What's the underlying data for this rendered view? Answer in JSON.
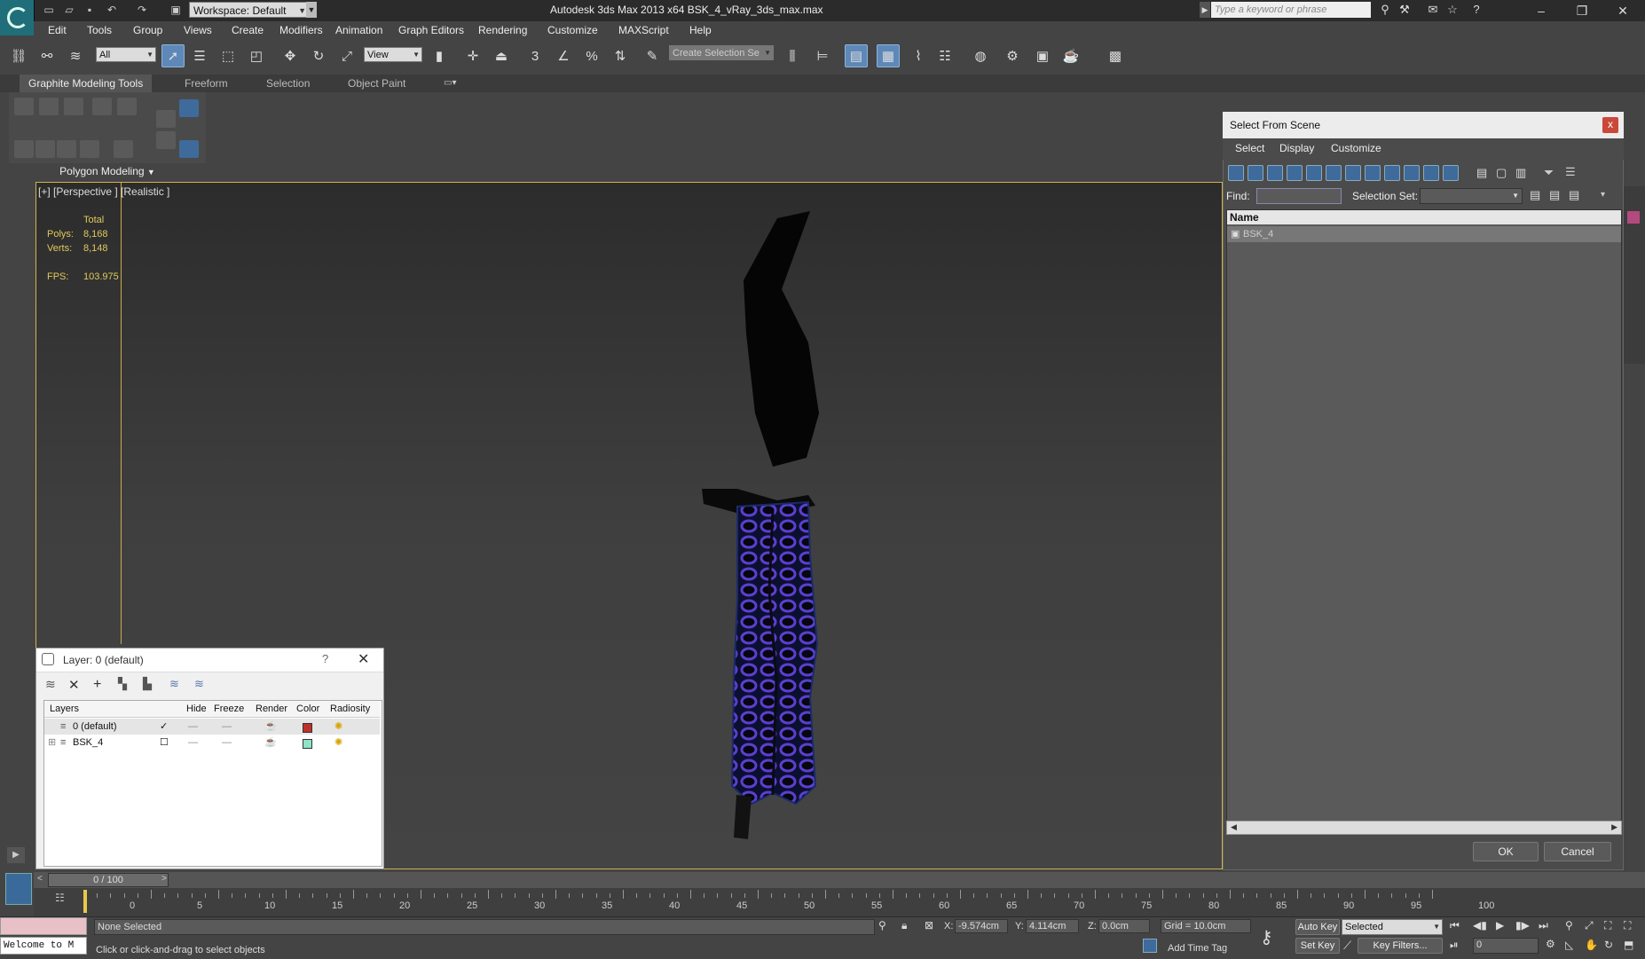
{
  "window": {
    "title": "Autodesk 3ds Max  2013 x64     BSK_4_vRay_3ds_max.max",
    "workspace": "Workspace: Default",
    "search_placeholder": "Type a keyword or phrase",
    "controls": [
      "–",
      "❐",
      "✕"
    ]
  },
  "menu": [
    "Edit",
    "Tools",
    "Group",
    "Views",
    "Create",
    "Modifiers",
    "Animation",
    "Graph Editors",
    "Rendering",
    "Customize",
    "MAXScript",
    "Help"
  ],
  "main_toolbar": {
    "selection_filter": "All",
    "ref_coord": "View",
    "named_selection_placeholder": "Create Selection Se"
  },
  "ribbon": {
    "tabs": [
      "Graphite Modeling Tools",
      "Freeform",
      "Selection",
      "Object Paint"
    ],
    "panel_label": "Polygon Modeling"
  },
  "viewport": {
    "label": "[+] [Perspective ] [Realistic ]",
    "stats": {
      "total_label": "Total",
      "polys_label": "Polys:",
      "polys": "8,168",
      "verts_label": "Verts:",
      "verts": "8,148",
      "fps_label": "FPS:",
      "fps": "103.975"
    }
  },
  "layer_dialog": {
    "title": "Layer: 0 (default)",
    "help": "?",
    "columns": [
      "Layers",
      "Hide",
      "Freeze",
      "Render",
      "Color",
      "Radiosity"
    ],
    "rows": [
      {
        "name": "0 (default)",
        "color": "#c0302a",
        "active": true
      },
      {
        "name": "BSK_4",
        "color": "#8ee3c8",
        "active": false
      }
    ]
  },
  "select_from_scene": {
    "title": "Select From Scene",
    "menu": [
      "Select",
      "Display",
      "Customize"
    ],
    "find_label": "Find:",
    "selection_set_label": "Selection Set:",
    "column_name": "Name",
    "items": [
      "BSK_4"
    ],
    "ok": "OK",
    "cancel": "Cancel"
  },
  "timeline": {
    "frame_display": "0 / 100",
    "ticks": [
      "0",
      "5",
      "10",
      "15",
      "20",
      "25",
      "30",
      "35",
      "40",
      "45",
      "50",
      "55",
      "60",
      "65",
      "70",
      "75",
      "80",
      "85",
      "90",
      "95",
      "100"
    ]
  },
  "status": {
    "maxscript": "Welcome to M",
    "selection": "None Selected",
    "prompt": "Click or click-and-drag to select objects",
    "x_label": "X:",
    "x": "-9.574cm",
    "y_label": "Y:",
    "y": "4.114cm",
    "z_label": "Z:",
    "z": "0.0cm",
    "grid": "Grid = 10.0cm",
    "add_time_tag": "Add Time Tag",
    "auto_key": "Auto Key",
    "set_key": "Set Key",
    "key_mode": "Selected",
    "key_filters": "Key Filters...",
    "frame": "0"
  },
  "colors": {
    "accent": "#5d88b8",
    "viewport_border": "#d2b34a",
    "stats": "#e1c95a",
    "knife_pattern": "#5b3fd0"
  }
}
